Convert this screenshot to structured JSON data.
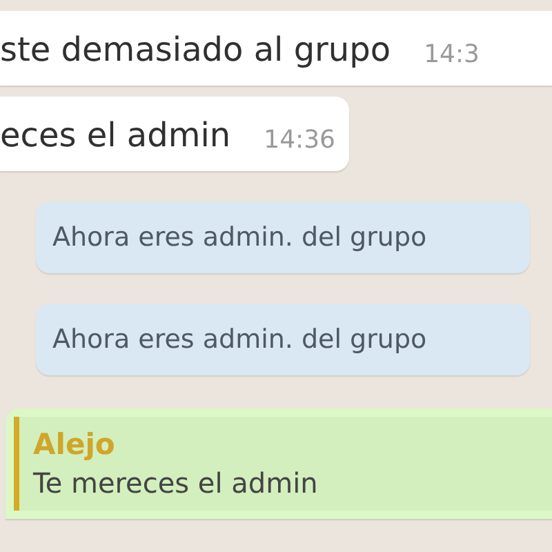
{
  "messages": [
    {
      "kind": "incoming",
      "text": "ste demasiado al grupo",
      "time": "14:3"
    },
    {
      "kind": "incoming",
      "text": "eces el admin",
      "time": "14:36"
    },
    {
      "kind": "system",
      "text": "Ahora eres admin. del grupo"
    },
    {
      "kind": "system",
      "text": "Ahora eres admin. del grupo"
    },
    {
      "kind": "reply",
      "quote_author": "Alejo",
      "quote_text": "Te mereces el admin"
    }
  ]
}
